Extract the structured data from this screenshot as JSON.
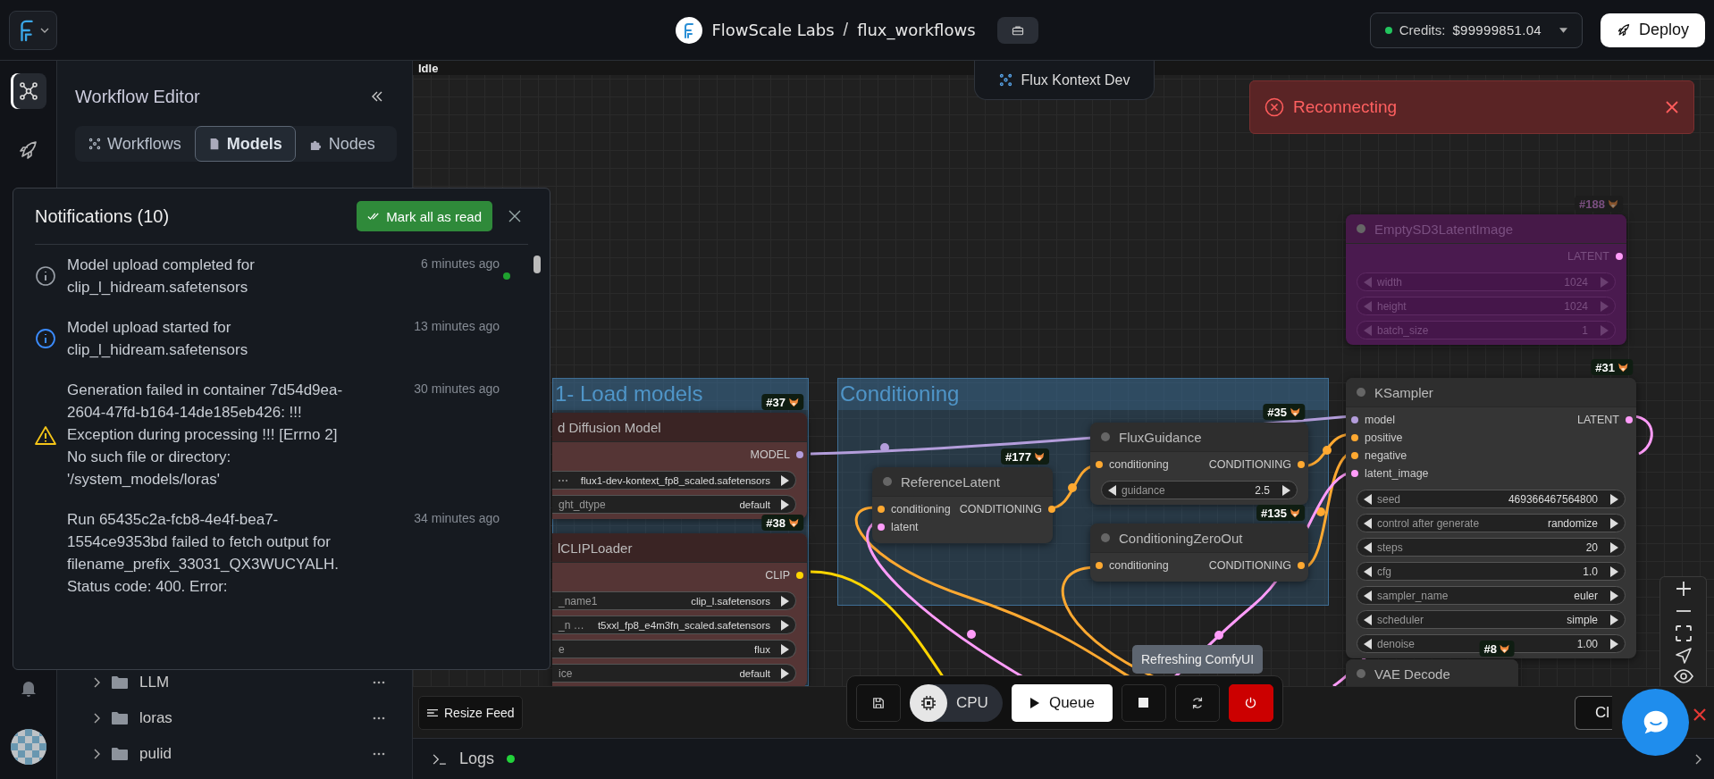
{
  "top_bar": {
    "org": "FlowScale Labs",
    "separator": "/",
    "project": "flux_workflows",
    "credits_label": "Credits:",
    "credits_value": "$99999851.04",
    "deploy_label": "Deploy"
  },
  "rail": {
    "top": [
      {
        "kind": "workflow",
        "selected": true
      },
      {
        "kind": "rocket",
        "selected": false
      }
    ],
    "bottom": [
      {
        "kind": "bell",
        "selected": false
      },
      {
        "kind": "avatar",
        "selected": false
      }
    ]
  },
  "sidebar": {
    "title": "Workflow Editor",
    "tabs": [
      {
        "kind": "workflows",
        "label": "Workflows",
        "selected": false
      },
      {
        "kind": "models",
        "label": "Models",
        "selected": true
      },
      {
        "kind": "nodes",
        "label": "Nodes",
        "selected": false
      }
    ],
    "folders": [
      {
        "name": "LLM",
        "expanded": false
      },
      {
        "name": "loras",
        "expanded": false
      },
      {
        "name": "pulid",
        "expanded": false
      }
    ]
  },
  "notifications": {
    "title": "Notifications (10)",
    "mark_all": "Mark all as read",
    "items": [
      {
        "kind": "note",
        "message": "Model upload completed for clip_l_hidream.safetensors",
        "time": "6 minutes ago",
        "unread": true
      },
      {
        "kind": "info",
        "message": "Model upload started for clip_l_hidream.safetensors",
        "time": "13 minutes ago",
        "unread": false
      },
      {
        "kind": "warning",
        "message": "Generation failed in container 7d54d9ea-2604-47fd-b164-14de185eb426: !!! Exception during processing !!! [Errno 2] No such file or directory: '/system_models/loras'",
        "time": "30 minutes ago",
        "unread": false
      },
      {
        "kind": "plain",
        "message": "Run 65435c2a-fcb8-4e4f-bea7-1554ce9353bd failed to fetch output for filename_prefix_33031_QX3WUCYALH. Status code: 400. Error:",
        "time": "34 minutes ago",
        "unread": false
      }
    ]
  },
  "canvas": {
    "status": "Idle",
    "workflow_tab": "Flux Kontext Dev",
    "toast": "Reconnecting",
    "tooltip": "Refreshing ComfyUI",
    "groups": [
      {
        "title": "1- Load models"
      },
      {
        "title": "Conditioning"
      }
    ],
    "nodes": [
      {
        "id": "#37",
        "kind": "loader",
        "title": "d Diffusion Model",
        "outputs": [
          {
            "name": "MODEL",
            "color": "#b39ddb"
          }
        ],
        "widgets": [
          {
            "value": "flux1-dev-kontext_fp8_scaled.safetensors"
          },
          {
            "label": "ght_dtype",
            "value": "default"
          }
        ]
      },
      {
        "id": "#38",
        "kind": "loader",
        "title": "lCLIPLoader",
        "outputs": [
          {
            "name": "CLIP",
            "color": "#ffd500"
          }
        ],
        "widgets": [
          {
            "label": "_name1",
            "value": "clip_l.safetensors"
          },
          {
            "label": "_n …",
            "value": "t5xxl_fp8_e4m3fn_scaled.safetensors"
          },
          {
            "label": "e",
            "value": "flux"
          },
          {
            "label": "ice",
            "value": "default"
          }
        ]
      },
      {
        "id": "#177",
        "kind": "default",
        "title": "ReferenceLatent",
        "inputs": [
          {
            "name": "conditioning",
            "color": "#ffa931"
          },
          {
            "name": "latent",
            "color": "#ff9cf9"
          }
        ],
        "outputs": [
          {
            "name": "CONDITIONING",
            "color": "#ffa931"
          }
        ]
      },
      {
        "id": "#35",
        "kind": "default",
        "title": "FluxGuidance",
        "inputs": [
          {
            "name": "conditioning",
            "color": "#ffa931"
          }
        ],
        "outputs": [
          {
            "name": "CONDITIONING",
            "color": "#ffa931"
          }
        ],
        "widgets": [
          {
            "label": "guidance",
            "value": "2.5"
          }
        ]
      },
      {
        "id": "#135",
        "kind": "default",
        "title": "ConditioningZeroOut",
        "inputs": [
          {
            "name": "conditioning",
            "color": "#ffa931"
          }
        ],
        "outputs": [
          {
            "name": "CONDITIONING",
            "color": "#ffa931"
          }
        ]
      },
      {
        "id": "#188",
        "kind": "bypassed",
        "title": "EmptySD3LatentImage",
        "outputs": [
          {
            "name": "LATENT",
            "color": "#ff9cf9"
          }
        ],
        "widgets": [
          {
            "label": "width",
            "value": "1024"
          },
          {
            "label": "height",
            "value": "1024"
          },
          {
            "label": "batch_size",
            "value": "1"
          }
        ]
      },
      {
        "id": "#31",
        "kind": "default",
        "title": "KSampler",
        "inputs": [
          {
            "name": "model",
            "color": "#b39ddb"
          },
          {
            "name": "positive",
            "color": "#ffa931"
          },
          {
            "name": "negative",
            "color": "#ffa931"
          },
          {
            "name": "latent_image",
            "color": "#ff9cf9"
          }
        ],
        "outputs": [
          {
            "name": "LATENT",
            "color": "#ff9cf9"
          }
        ],
        "widgets": [
          {
            "label": "seed",
            "value": "469366467564800"
          },
          {
            "label": "control after generate",
            "value": "randomize"
          },
          {
            "label": "steps",
            "value": "20"
          },
          {
            "label": "cfg",
            "value": "1.0"
          },
          {
            "label": "sampler_name",
            "value": "euler"
          },
          {
            "label": "scheduler",
            "value": "simple"
          },
          {
            "label": "denoise",
            "value": "1.00"
          }
        ]
      },
      {
        "id": "#8",
        "kind": "default",
        "title": "VAE Decode"
      }
    ]
  },
  "toolbar": {
    "cpu_label": "CPU",
    "queue_label": "Queue"
  },
  "feed": {
    "resize_label": "Resize Feed",
    "close_label": "Cl"
  },
  "logs": {
    "label": "Logs",
    "connected": true
  }
}
